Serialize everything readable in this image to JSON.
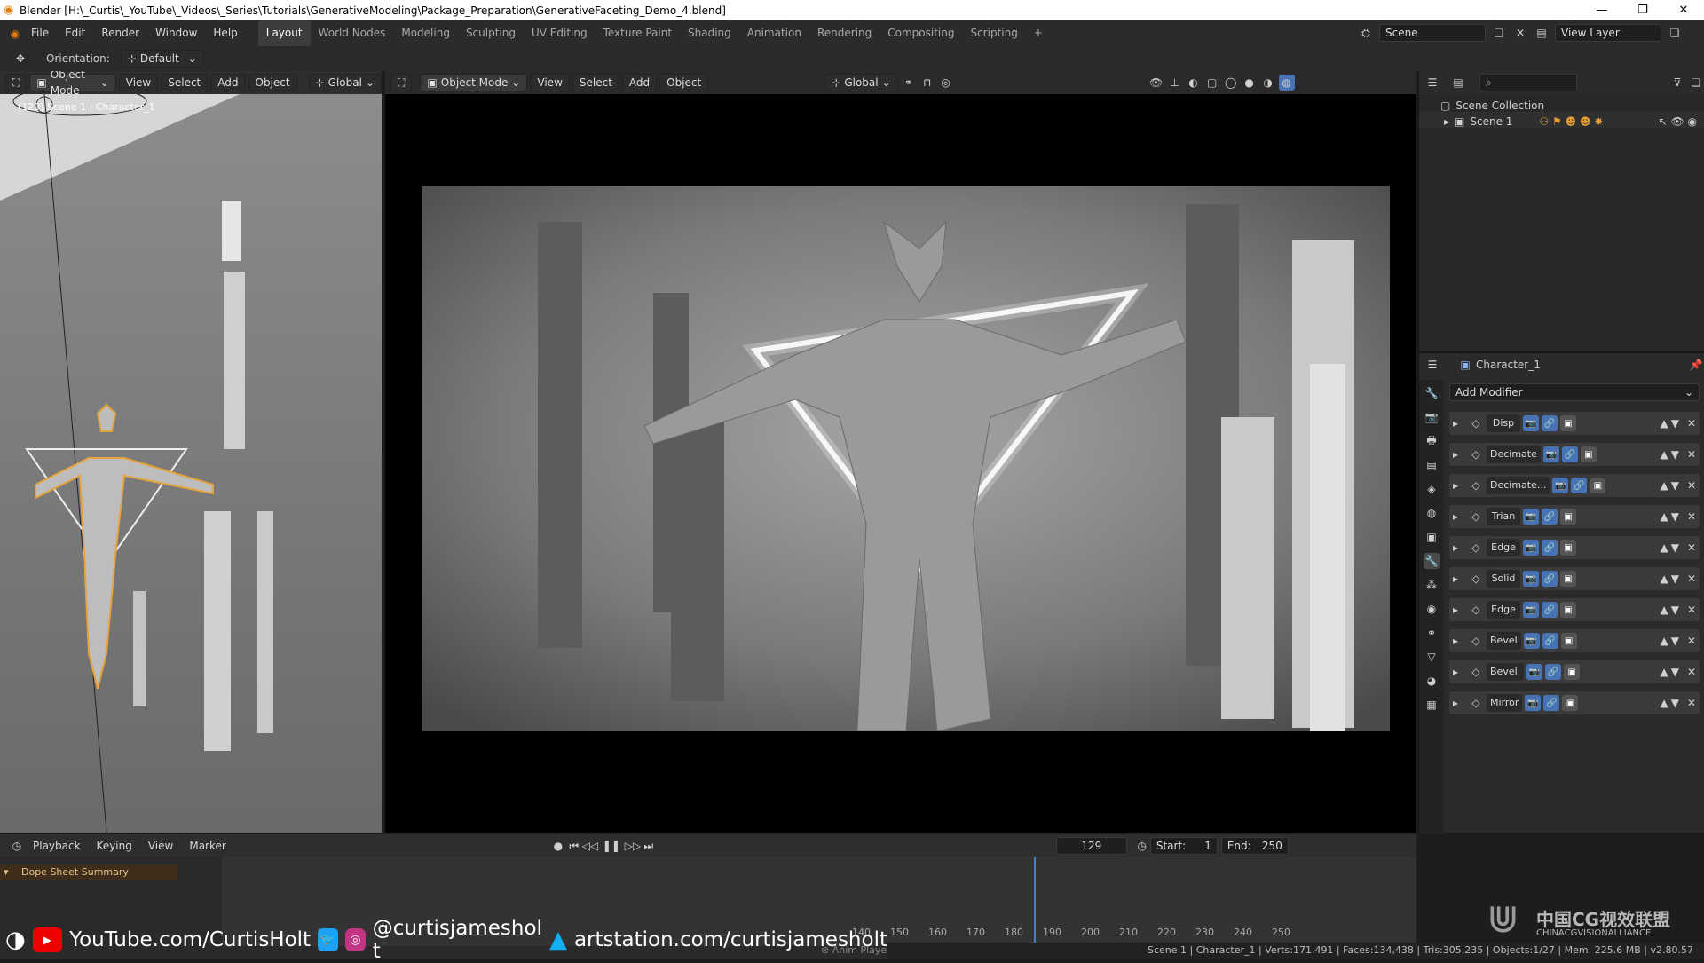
{
  "window": {
    "title": "Blender [H:\\_Curtis\\_YouTube\\_Videos\\_Series\\Tutorials\\GenerativeModeling\\Package_Preparation\\GenerativeFaceting_Demo_4.blend]"
  },
  "menu": [
    "File",
    "Edit",
    "Render",
    "Window",
    "Help"
  ],
  "workspace_tabs": [
    "Layout",
    "World Nodes",
    "Modeling",
    "Sculpting",
    "UV Editing",
    "Texture Paint",
    "Shading",
    "Animation",
    "Rendering",
    "Compositing",
    "Scripting"
  ],
  "scene_field": "Scene",
  "view_layer_field": "View Layer",
  "tool_settings": {
    "orientation_label": "Orientation:",
    "orientation_value": "Default"
  },
  "left_viewport": {
    "mode": "Object Mode",
    "menus": [
      "View",
      "Select",
      "Add",
      "Object"
    ],
    "transform": "Global",
    "info_text": "(129) Scene 1 | Character_1"
  },
  "main_viewport": {
    "mode": "Object Mode",
    "menus": [
      "View",
      "Select",
      "Add",
      "Object"
    ],
    "transform": "Global"
  },
  "outliner": {
    "collection": "Scene Collection",
    "item": "Scene 1"
  },
  "properties": {
    "object_name": "Character_1",
    "add_modifier": "Add Modifier",
    "modifiers": [
      "Disp",
      "Decimate",
      "Decimate...",
      "Trian",
      "Edge",
      "Solid",
      "Edge",
      "Bevel",
      "Bevel.",
      "Mirror"
    ]
  },
  "timeline": {
    "menus": [
      "Playback",
      "Keying",
      "View",
      "Marker"
    ],
    "current_frame": "129",
    "start_label": "Start:",
    "start_value": "1",
    "end_label": "End:",
    "end_value": "250",
    "summary": "Dope Sheet Summary",
    "frame_numbers": [
      "140",
      "150",
      "160",
      "170",
      "180",
      "190",
      "200",
      "210",
      "220",
      "230",
      "240",
      "250"
    ]
  },
  "overlay": {
    "youtube": "YouTube.com/CurtisHolt",
    "social": "@curtisjameshol t",
    "artstation": "artstation.com/curtisjamesholt"
  },
  "status_bar": "Scene 1 | Character_1 | Verts:171,491 | Faces:134,438 | Tris:305,235 | Objects:1/27 | Mem: 225.6 MB | v2.80.57",
  "status_hint": "Anim Player",
  "watermark": {
    "cn": "中国CG视效联盟",
    "en": "CHINACGVISIONALLIANCE"
  }
}
